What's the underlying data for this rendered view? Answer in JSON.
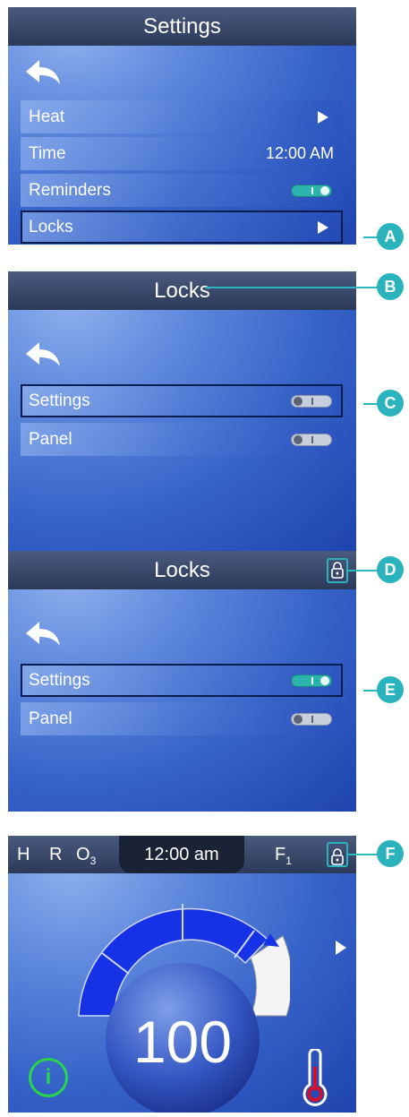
{
  "panel1": {
    "title": "Settings",
    "rows": [
      {
        "label": "Heat"
      },
      {
        "label": "Time",
        "value": "12:00 AM"
      },
      {
        "label": "Reminders"
      },
      {
        "label": "Locks"
      }
    ]
  },
  "panel2": {
    "title": "Locks",
    "rows": [
      {
        "label": "Settings"
      },
      {
        "label": "Panel"
      }
    ]
  },
  "panel3": {
    "title": "Locks",
    "rows": [
      {
        "label": "Settings"
      },
      {
        "label": "Panel"
      }
    ]
  },
  "panel4": {
    "status": {
      "h": "H",
      "r": "R",
      "o": "O",
      "o_sub": "3",
      "time": "12:00 am",
      "f": "F",
      "f_sub": "1"
    },
    "temperature": "100",
    "info_label": "i"
  },
  "callouts": {
    "a": "A",
    "b": "B",
    "c": "C",
    "d": "D",
    "e": "E",
    "f": "F"
  },
  "colors": {
    "accent": "#2ab3bd",
    "toggle_on": "#2db3ae",
    "dial_blue": "#1632e6",
    "info_green": "#27d64a",
    "thermo_red": "#d1112d"
  }
}
